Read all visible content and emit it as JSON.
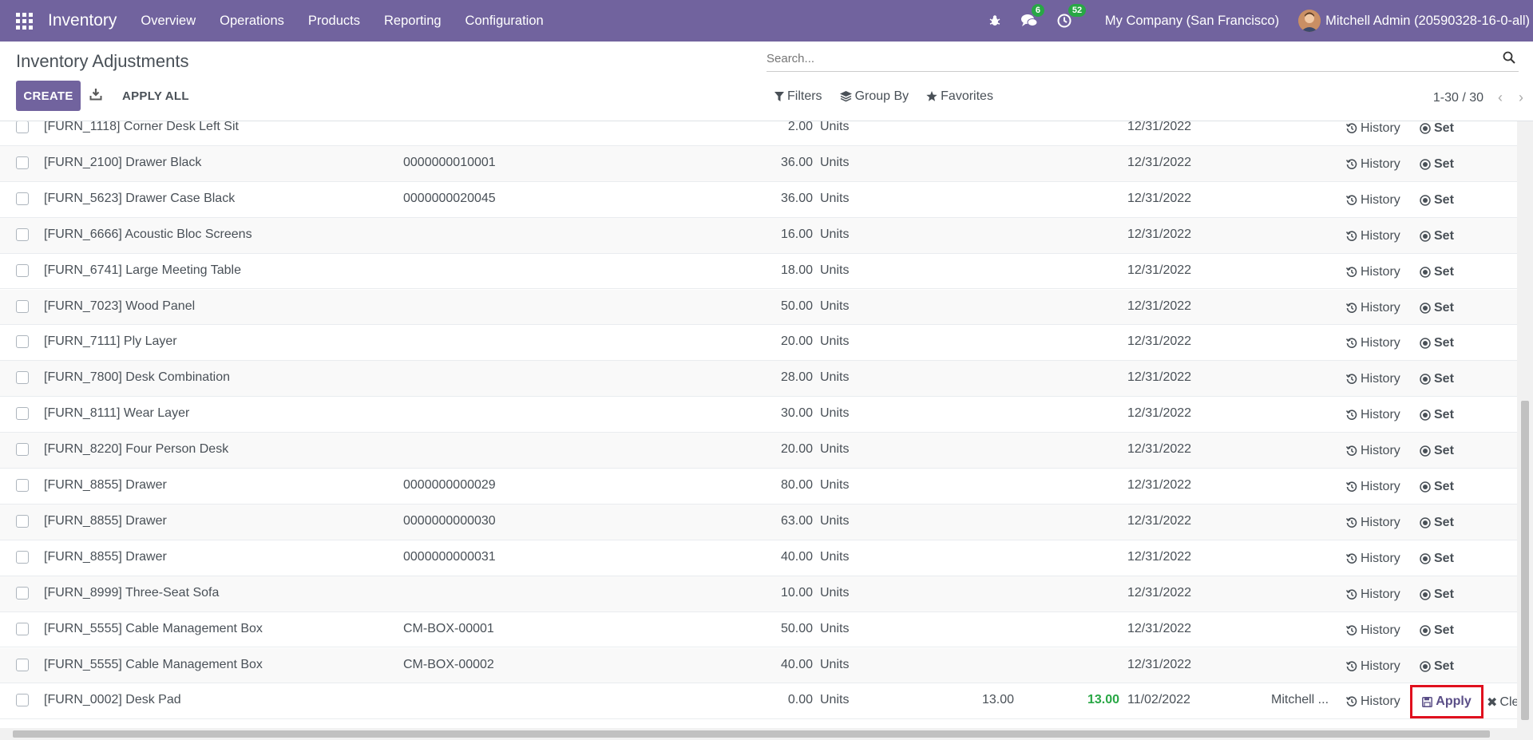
{
  "navbar": {
    "brand": "Inventory",
    "menu": [
      "Overview",
      "Operations",
      "Products",
      "Reporting",
      "Configuration"
    ],
    "messages_count": "6",
    "activities_count": "52",
    "company": "My Company (San Francisco)",
    "user": "Mitchell Admin (20590328-16-0-all)",
    "brand_color": "#71639e"
  },
  "control_panel": {
    "title": "Inventory Adjustments",
    "create_label": "CREATE",
    "apply_all_label": "APPLY ALL",
    "search_placeholder": "Search...",
    "filters_label": "Filters",
    "group_by_label": "Group By",
    "favorites_label": "Favorites",
    "pager": "1-30 / 30"
  },
  "list": {
    "history_label": "History",
    "set_label": "Set",
    "apply_label": "Apply",
    "clear_label": "Cle",
    "rows": [
      {
        "product": "[FURN_1118] Corner Desk Left Sit",
        "lot": "",
        "qty": "2.00",
        "uom": "Units",
        "count": "",
        "diff": "",
        "date": "12/31/2022",
        "user": ""
      },
      {
        "product": "[FURN_2100] Drawer Black",
        "lot": "0000000010001",
        "qty": "36.00",
        "uom": "Units",
        "count": "",
        "diff": "",
        "date": "12/31/2022",
        "user": ""
      },
      {
        "product": "[FURN_5623] Drawer Case Black",
        "lot": "0000000020045",
        "qty": "36.00",
        "uom": "Units",
        "count": "",
        "diff": "",
        "date": "12/31/2022",
        "user": ""
      },
      {
        "product": "[FURN_6666] Acoustic Bloc Screens",
        "lot": "",
        "qty": "16.00",
        "uom": "Units",
        "count": "",
        "diff": "",
        "date": "12/31/2022",
        "user": ""
      },
      {
        "product": "[FURN_6741] Large Meeting Table",
        "lot": "",
        "qty": "18.00",
        "uom": "Units",
        "count": "",
        "diff": "",
        "date": "12/31/2022",
        "user": ""
      },
      {
        "product": "[FURN_7023] Wood Panel",
        "lot": "",
        "qty": "50.00",
        "uom": "Units",
        "count": "",
        "diff": "",
        "date": "12/31/2022",
        "user": ""
      },
      {
        "product": "[FURN_7111] Ply Layer",
        "lot": "",
        "qty": "20.00",
        "uom": "Units",
        "count": "",
        "diff": "",
        "date": "12/31/2022",
        "user": ""
      },
      {
        "product": "[FURN_7800] Desk Combination",
        "lot": "",
        "qty": "28.00",
        "uom": "Units",
        "count": "",
        "diff": "",
        "date": "12/31/2022",
        "user": ""
      },
      {
        "product": "[FURN_8111] Wear Layer",
        "lot": "",
        "qty": "30.00",
        "uom": "Units",
        "count": "",
        "diff": "",
        "date": "12/31/2022",
        "user": ""
      },
      {
        "product": "[FURN_8220] Four Person Desk",
        "lot": "",
        "qty": "20.00",
        "uom": "Units",
        "count": "",
        "diff": "",
        "date": "12/31/2022",
        "user": ""
      },
      {
        "product": "[FURN_8855] Drawer",
        "lot": "0000000000029",
        "qty": "80.00",
        "uom": "Units",
        "count": "",
        "diff": "",
        "date": "12/31/2022",
        "user": ""
      },
      {
        "product": "[FURN_8855] Drawer",
        "lot": "0000000000030",
        "qty": "63.00",
        "uom": "Units",
        "count": "",
        "diff": "",
        "date": "12/31/2022",
        "user": ""
      },
      {
        "product": "[FURN_8855] Drawer",
        "lot": "0000000000031",
        "qty": "40.00",
        "uom": "Units",
        "count": "",
        "diff": "",
        "date": "12/31/2022",
        "user": ""
      },
      {
        "product": "[FURN_8999] Three-Seat Sofa",
        "lot": "",
        "qty": "10.00",
        "uom": "Units",
        "count": "",
        "diff": "",
        "date": "12/31/2022",
        "user": ""
      },
      {
        "product": "[FURN_5555] Cable Management Box",
        "lot": "CM-BOX-00001",
        "qty": "50.00",
        "uom": "Units",
        "count": "",
        "diff": "",
        "date": "12/31/2022",
        "user": ""
      },
      {
        "product": "[FURN_5555] Cable Management Box",
        "lot": "CM-BOX-00002",
        "qty": "40.00",
        "uom": "Units",
        "count": "",
        "diff": "",
        "date": "12/31/2022",
        "user": ""
      },
      {
        "product": "[FURN_0002] Desk Pad",
        "lot": "",
        "qty": "0.00",
        "uom": "Units",
        "count": "13.00",
        "diff": "13.00",
        "date": "11/02/2022",
        "user": "Mitchell ..."
      }
    ]
  }
}
